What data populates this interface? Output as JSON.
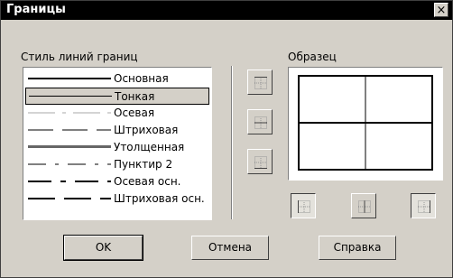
{
  "window": {
    "title": "Границы",
    "close_glyph": "×"
  },
  "labels": {
    "line_style": "Стиль линий границ",
    "sample": "Образец"
  },
  "line_styles": [
    {
      "label": "Основная"
    },
    {
      "label": "Тонкая"
    },
    {
      "label": "Осевая"
    },
    {
      "label": "Штриховая"
    },
    {
      "label": "Утолщенная"
    },
    {
      "label": "Пунктир 2"
    },
    {
      "label": "Осевая осн."
    },
    {
      "label": "Штриховая осн."
    }
  ],
  "selected_line_style": "Тонкая",
  "buttons": {
    "ok": "OK",
    "cancel": "Отмена",
    "help": "Справка"
  },
  "colors": {
    "dialog_bg": "#d4d0c8",
    "titlebar": "#000000"
  }
}
